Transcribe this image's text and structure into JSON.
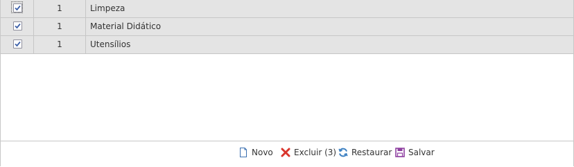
{
  "rows": [
    {
      "checked": true,
      "number": "1",
      "name": "Limpeza"
    },
    {
      "checked": true,
      "number": "1",
      "name": "Material Didático"
    },
    {
      "checked": true,
      "number": "1",
      "name": "Utensílios"
    }
  ],
  "toolbar": {
    "new_label": "Novo",
    "delete_label": "Excluir (3)",
    "restore_label": "Restaurar",
    "save_label": "Salvar"
  },
  "colors": {
    "row_bg": "#e4e4e4",
    "check": "#3b5fa8",
    "delete": "#d9342b",
    "restore": "#3a7fc1",
    "save": "#8e3fa0"
  },
  "icons": {
    "new": "new-document-icon",
    "delete": "red-x-icon",
    "restore": "refresh-icon",
    "save": "floppy-disk-icon"
  }
}
